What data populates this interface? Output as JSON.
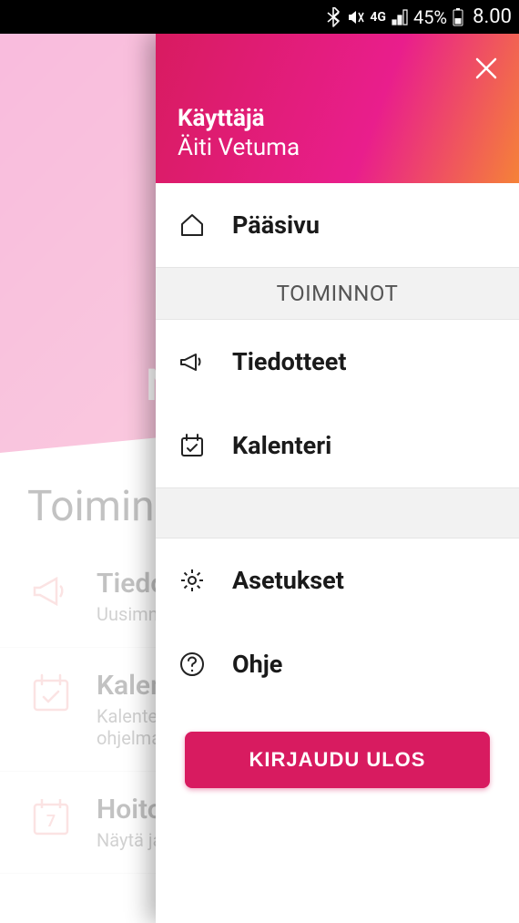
{
  "status_bar": {
    "battery_pct": "45%",
    "time": "8.00",
    "network": "4G"
  },
  "background": {
    "hero_text": "N",
    "section_title": "Toiminn",
    "items": [
      {
        "title": "Tiedo",
        "sub": "Uusimn"
      },
      {
        "title": "Kalen",
        "sub": "Kalente\nohjelma"
      },
      {
        "title": "Hoito",
        "sub": "Näytä ja"
      }
    ]
  },
  "drawer": {
    "header_label": "Käyttäjä",
    "header_name": "Äiti Vetuma",
    "menu": {
      "home": "Pääsivu",
      "section_functions": "TOIMINNOT",
      "announcements": "Tiedotteet",
      "calendar": "Kalenteri",
      "settings": "Asetukset",
      "help": "Ohje"
    },
    "logout": "KIRJAUDU ULOS"
  }
}
